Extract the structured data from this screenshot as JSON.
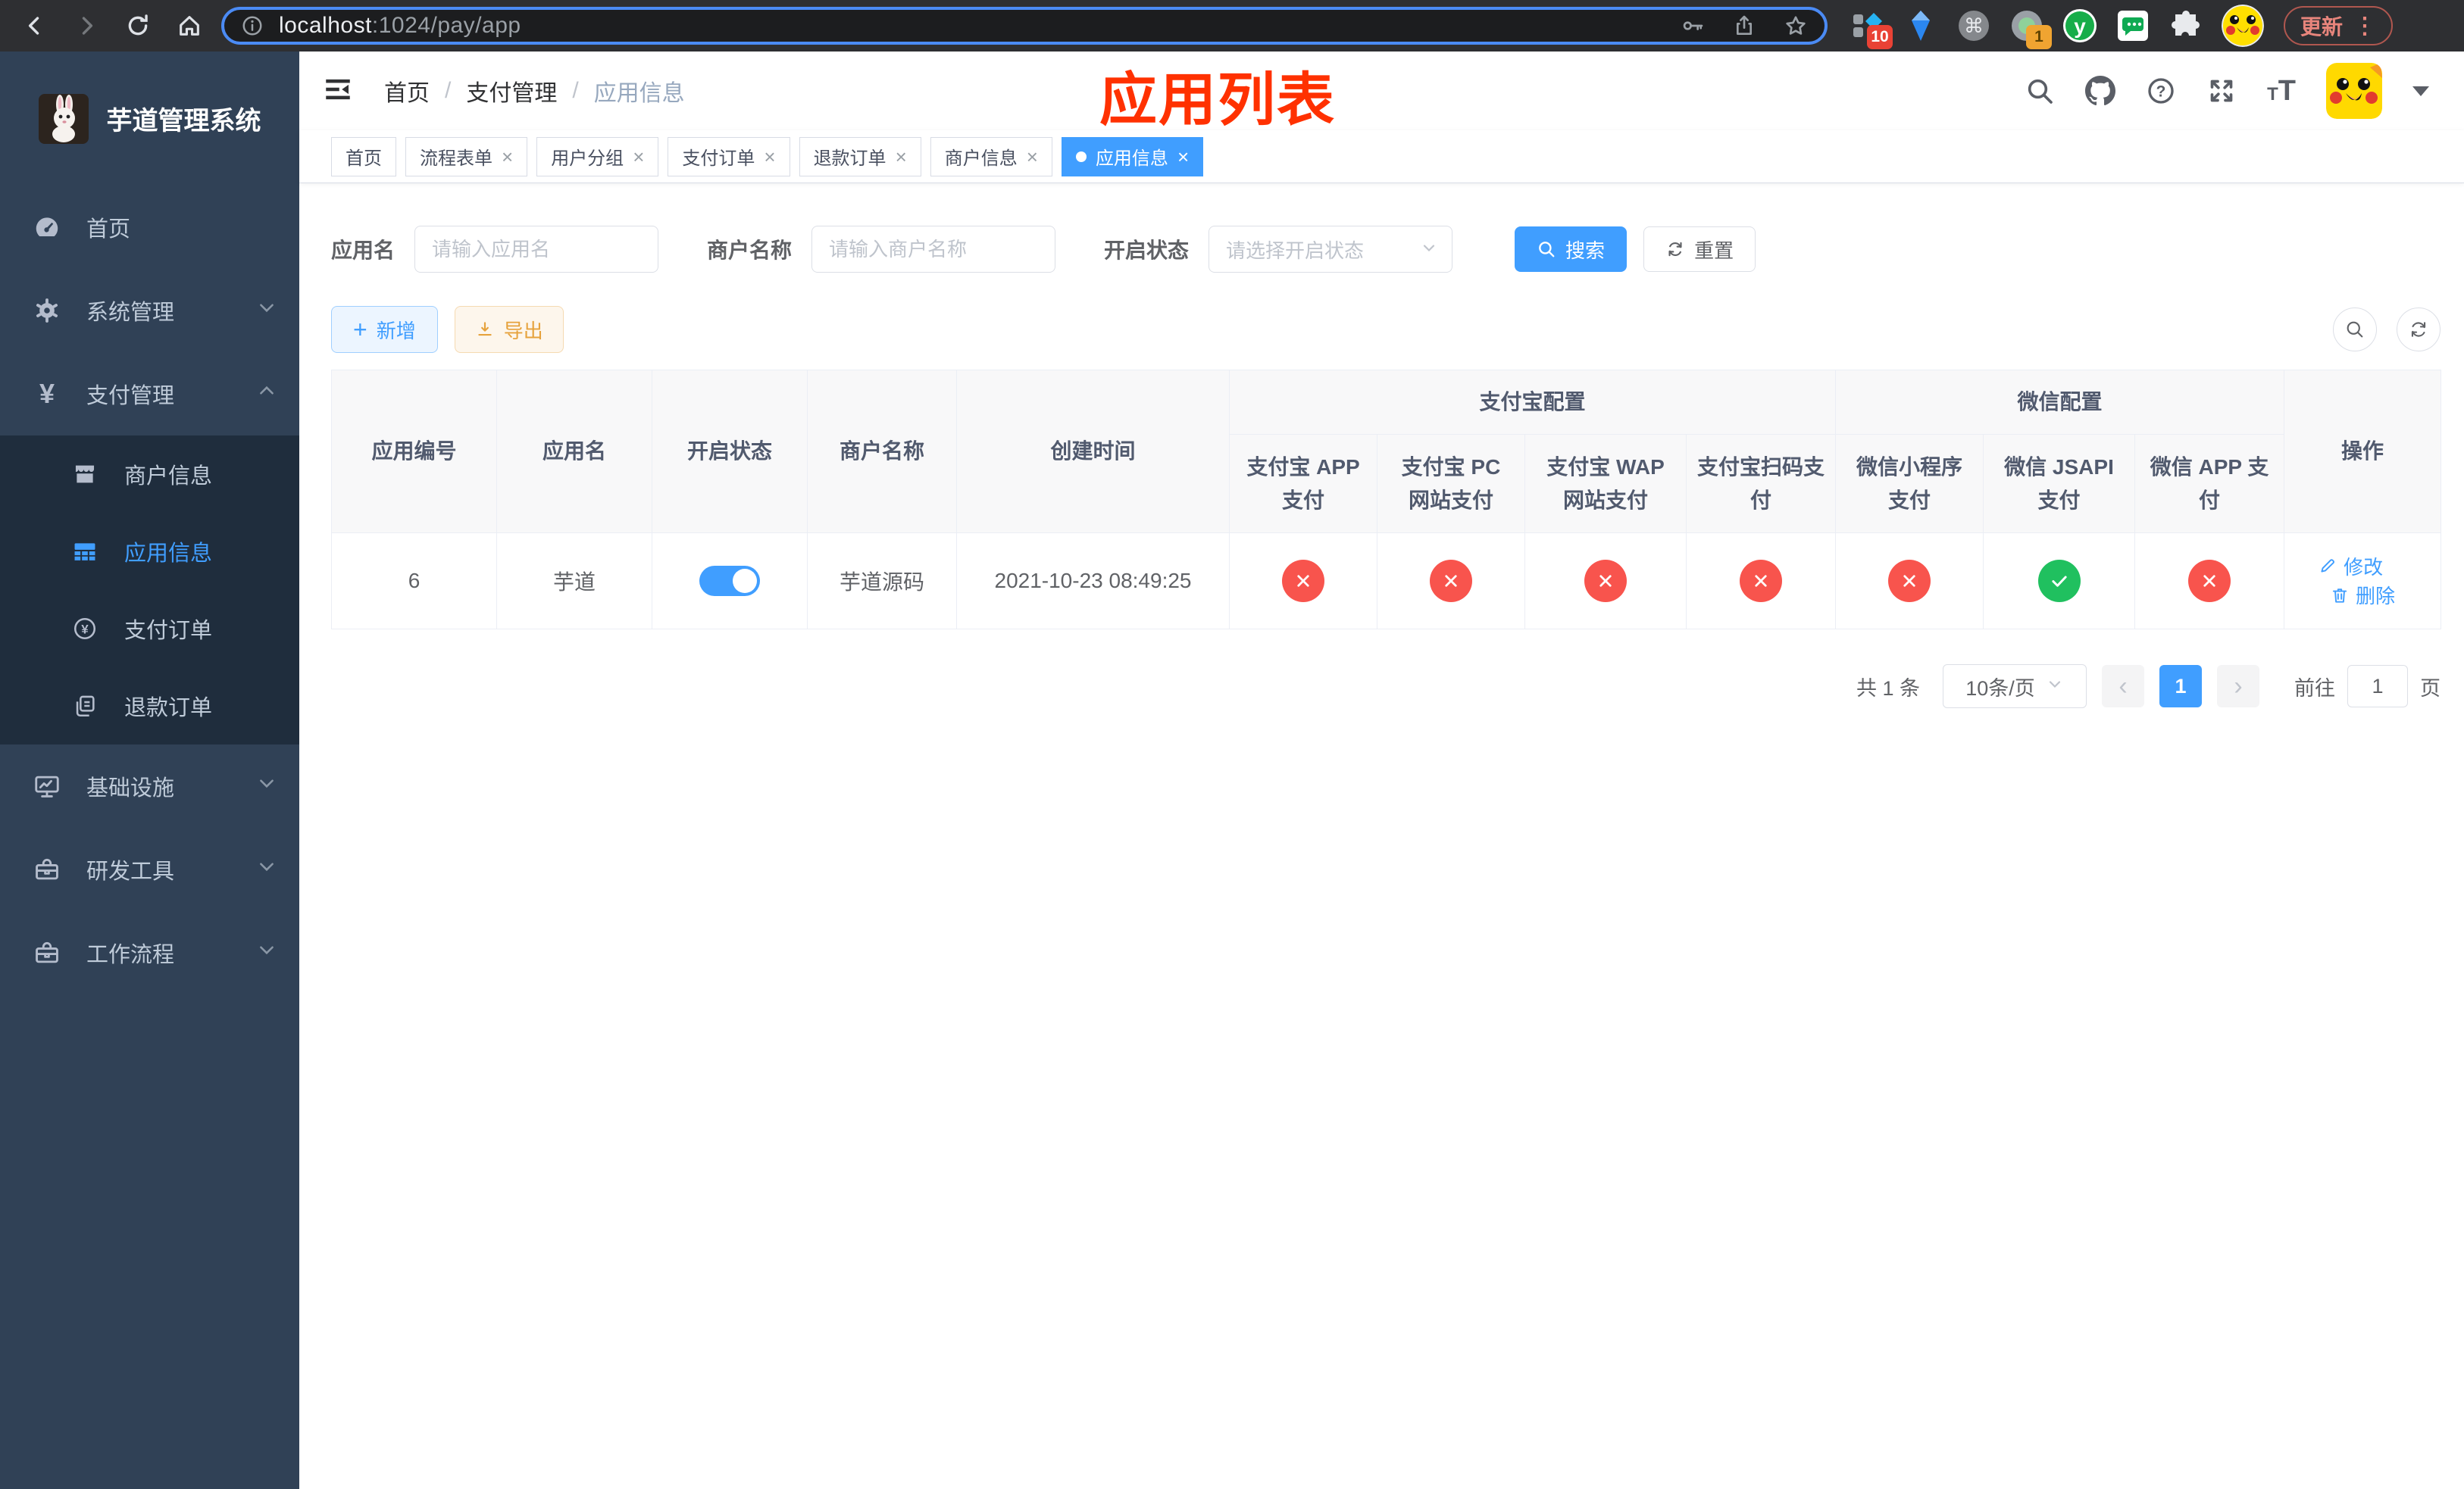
{
  "colors": {
    "accent": "#409eff",
    "success": "#20c05f",
    "danger": "#f8544d",
    "annotation": "#ff3100"
  },
  "browser": {
    "url": {
      "host": "localhost",
      "path": ":1024/pay/app"
    },
    "update_label": "更新",
    "menu_dots": "⋮",
    "ext_letter": "y",
    "badges": {
      "sider": "10",
      "recorder": "1"
    },
    "command_glyph": "⌘"
  },
  "sidebar": {
    "title": "芋道管理系统",
    "menu": [
      {
        "label": "首页"
      },
      {
        "label": "系统管理"
      },
      {
        "label": "支付管理"
      },
      {
        "label": "基础设施"
      },
      {
        "label": "研发工具"
      },
      {
        "label": "工作流程"
      }
    ],
    "payment_children": [
      {
        "label": "商户信息"
      },
      {
        "label": "应用信息"
      },
      {
        "label": "支付订单"
      },
      {
        "label": "退款订单"
      }
    ]
  },
  "navbar": {
    "breadcrumb": [
      "首页",
      "支付管理",
      "应用信息"
    ],
    "separator": "/",
    "annotation": "应用列表"
  },
  "tabs": [
    {
      "label": "首页"
    },
    {
      "label": "流程表单"
    },
    {
      "label": "用户分组"
    },
    {
      "label": "支付订单"
    },
    {
      "label": "退款订单"
    },
    {
      "label": "商户信息"
    },
    {
      "label": "应用信息"
    }
  ],
  "tab_close_glyph": "×",
  "search": {
    "app_name": {
      "label": "应用名",
      "placeholder": "请输入应用名"
    },
    "merchant": {
      "label": "商户名称",
      "placeholder": "请输入商户名称"
    },
    "status": {
      "label": "开启状态",
      "placeholder": "请选择开启状态"
    },
    "submit": "搜索",
    "reset": "重置"
  },
  "toolbar": {
    "add": "新增",
    "export": "导出"
  },
  "table": {
    "headers": {
      "app_no": "应用编号",
      "app_name": "应用名",
      "status": "开启状态",
      "merchant": "商户名称",
      "created": "创建时间",
      "alipay_group": "支付宝配置",
      "wechat_group": "微信配置",
      "channels": [
        "支付宝 APP 支付",
        "支付宝 PC 网站支付",
        "支付宝 WAP 网站支付",
        "支付宝扫码支付",
        "微信小程序支付",
        "微信 JSAPI 支付",
        "微信 APP 支付"
      ],
      "ops": "操作"
    },
    "row": {
      "app_no": "6",
      "app_name": "芋道",
      "enabled": true,
      "merchant": "芋道源码",
      "created": "2021-10-23 08:49:25",
      "channels": [
        "fail",
        "fail",
        "fail",
        "fail",
        "fail",
        "ok",
        "fail"
      ],
      "edit": "修改",
      "delete": "删除"
    }
  },
  "pagination": {
    "total": "共 1 条",
    "page_size": "10条/页",
    "prev": "‹",
    "page": "1",
    "next": "›",
    "goto_prefix": "前往",
    "goto_value": "1",
    "goto_suffix": "页"
  }
}
